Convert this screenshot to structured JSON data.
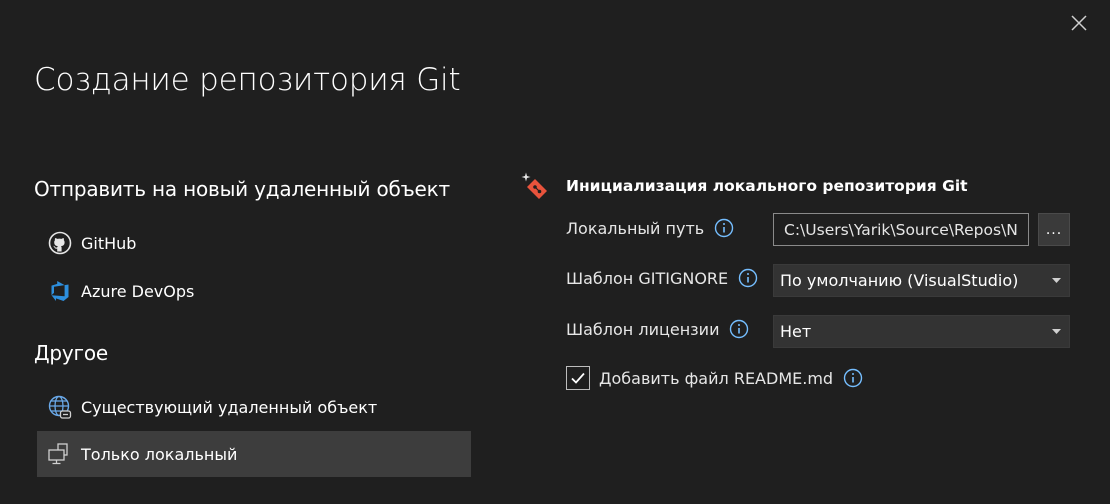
{
  "window": {
    "title": "Создание репозитория Git"
  },
  "left": {
    "push_heading": "Отправить на новый удаленный объект",
    "push_items": [
      {
        "label": "GitHub",
        "icon": "github-icon"
      },
      {
        "label": "Azure DevOps",
        "icon": "azure-devops-icon"
      }
    ],
    "other_heading": "Другое",
    "other_items": [
      {
        "label": "Существующий удаленный объект",
        "icon": "globe-icon"
      },
      {
        "label": "Только локальный",
        "icon": "local-computer-icon",
        "selected": true
      }
    ]
  },
  "panel": {
    "title": "Инициализация локального репозитория Git",
    "local_path_label": "Локальный путь",
    "local_path_value": "C:\\Users\\Yarik\\Source\\Repos\\N",
    "browse_label": "...",
    "gitignore_label": "Шаблон GITIGNORE",
    "gitignore_value": "По умолчанию (VisualStudio)",
    "license_label": "Шаблон лицензии",
    "license_value": "Нет",
    "readme_label": "Добавить файл README.md",
    "readme_checked": true
  },
  "colors": {
    "background": "#1f1f1f",
    "selected_item": "#3d3d3d",
    "select_bg": "#333333",
    "info_blue": "#75beff",
    "azure_blue": "#2d8fde",
    "git_red": "#e8533c"
  }
}
